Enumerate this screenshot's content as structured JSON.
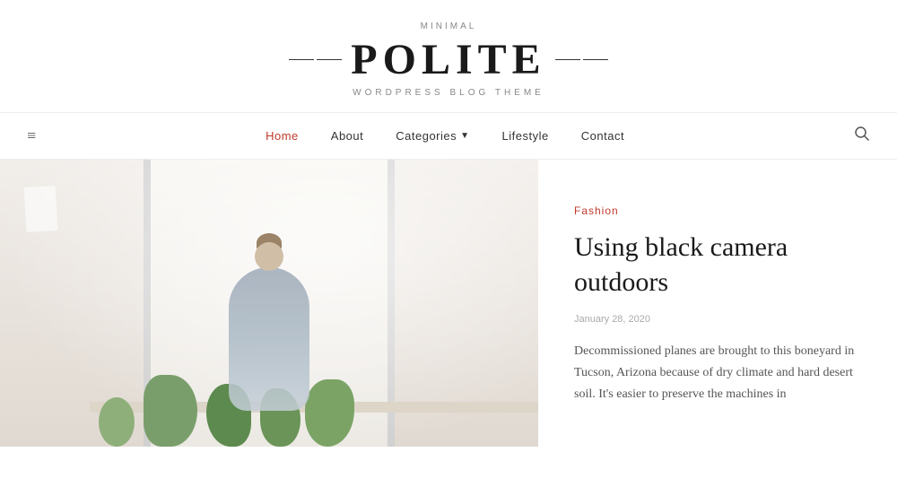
{
  "site": {
    "tagline": "MINIMAL",
    "title": "POLITE",
    "subtitle": "WORDPRESS BLOG THEME"
  },
  "nav": {
    "menu_icon": "≡",
    "search_icon": "🔍",
    "links": [
      {
        "label": "Home",
        "active": true
      },
      {
        "label": "About",
        "active": false
      },
      {
        "label": "Categories",
        "has_dropdown": true,
        "active": false
      },
      {
        "label": "Lifestyle",
        "active": false
      },
      {
        "label": "Contact",
        "active": false
      }
    ]
  },
  "featured_post": {
    "category": "Fashion",
    "title": "Using black camera outdoors",
    "date": "January 28, 2020",
    "excerpt": "Decommissioned planes are brought to this boneyard in Tucson, Arizona because of dry climate and hard desert soil. It's easier to preserve the machines in"
  }
}
